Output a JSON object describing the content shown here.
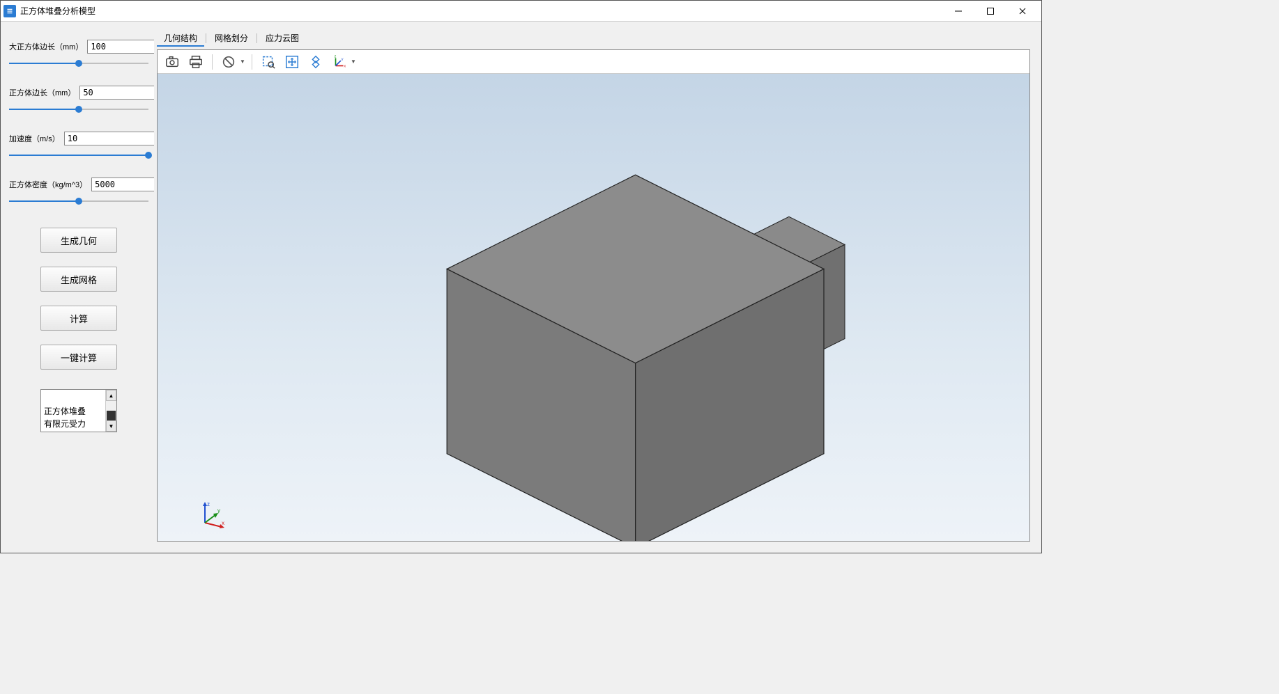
{
  "window": {
    "title": "正方体堆叠分析模型"
  },
  "params": {
    "big_cube": {
      "label": "大正方体边长（mm）",
      "value": "100",
      "slider_pct": 50
    },
    "cube": {
      "label": "正方体边长（mm）",
      "value": "50",
      "slider_pct": 50
    },
    "accel": {
      "label": "加速度（m/s）",
      "value": "10",
      "slider_pct": 100
    },
    "density": {
      "label": "正方体密度（kg/m^3）",
      "value": "5000",
      "slider_pct": 50
    }
  },
  "buttons": {
    "gen_geom": "生成几何",
    "gen_mesh": "生成网格",
    "compute": "计算",
    "one_click": "一键计算"
  },
  "listbox": {
    "line1": "正方体堆叠",
    "line2": "有限元受力"
  },
  "tabs": {
    "geom": "几何结构",
    "mesh": "网格划分",
    "stress": "应力云图",
    "active": "geom"
  },
  "toolbar_icons": {
    "camera": "camera-icon",
    "print": "print-icon",
    "forbid": "forbid-icon",
    "zoom_sel": "zoom-selection-icon",
    "fit": "fit-view-icon",
    "rotate": "rotate-icon",
    "axes": "axes-icon"
  },
  "colors": {
    "accent": "#2b7cd3",
    "cube_fill": "#7e7e7e"
  }
}
